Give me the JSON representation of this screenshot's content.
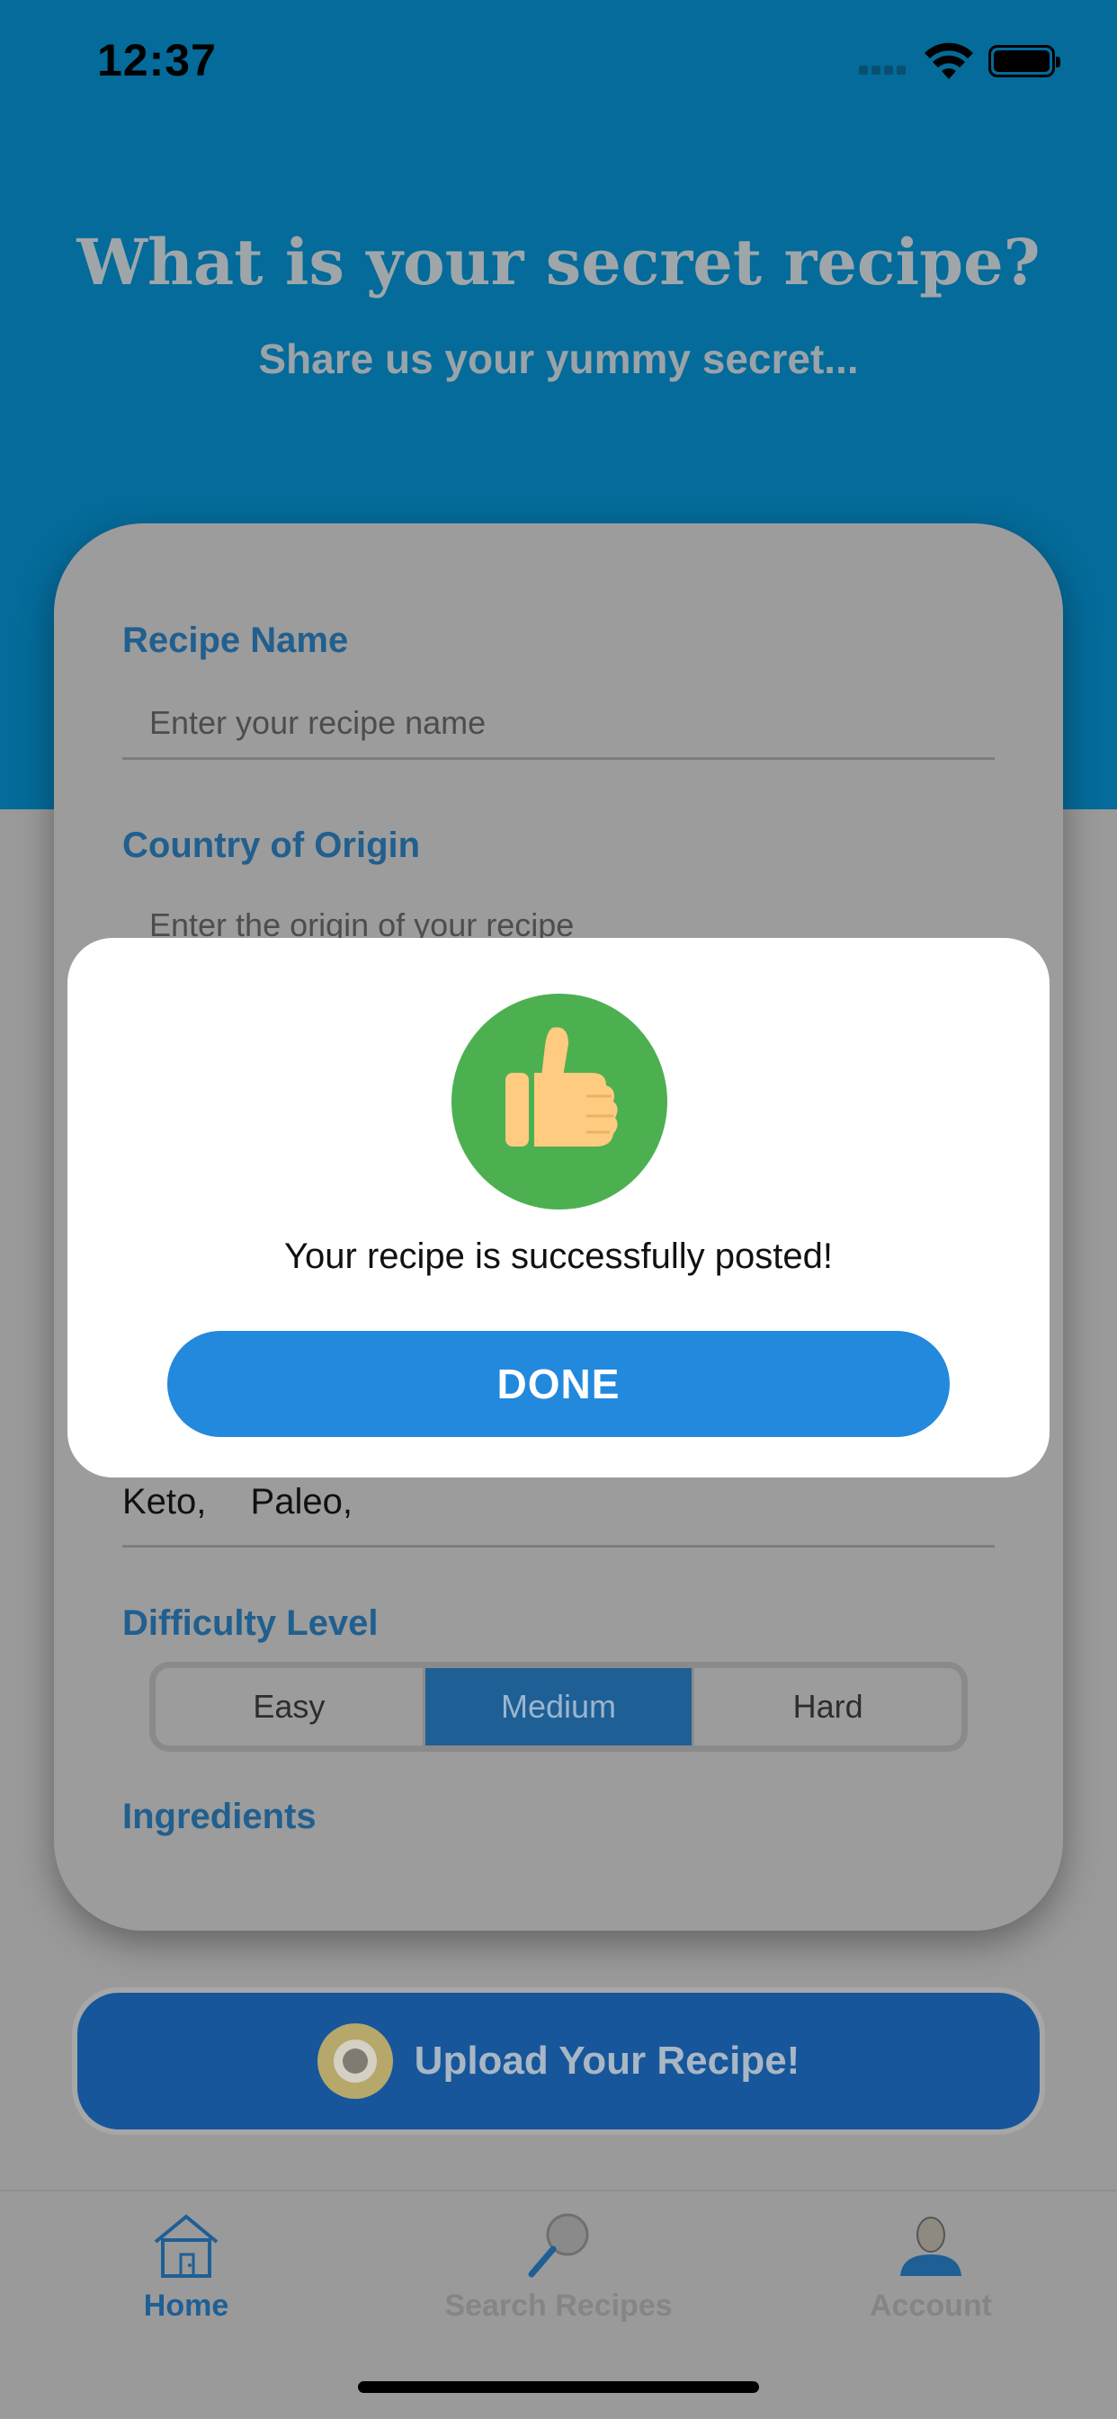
{
  "status_bar": {
    "time": "12:37"
  },
  "header": {
    "title": "What is your secret recipe?",
    "subtitle": "Share us your yummy secret..."
  },
  "form": {
    "recipe_name": {
      "label": "Recipe Name",
      "placeholder": "Enter your recipe name"
    },
    "country": {
      "label": "Country of Origin",
      "placeholder": "Enter the origin of your recipe"
    },
    "tags": [
      "Keto,",
      "Paleo,"
    ],
    "difficulty": {
      "label": "Difficulty Level",
      "options": [
        "Easy",
        "Medium",
        "Hard"
      ],
      "selected": "Medium"
    },
    "ingredients": {
      "label": "Ingredients"
    }
  },
  "upload_button": {
    "label": "Upload Your Recipe!"
  },
  "modal": {
    "message": "Your recipe is successfully posted!",
    "button": "DONE",
    "icon": "thumbs-up-icon"
  },
  "tabbar": {
    "items": [
      {
        "label": "Home",
        "icon": "home-icon",
        "active": true,
        "color": "#1e5f95"
      },
      {
        "label": "Search Recipes",
        "icon": "search-icon",
        "active": false,
        "color": "#858585"
      },
      {
        "label": "Account",
        "icon": "account-icon",
        "active": false,
        "color": "#858585"
      }
    ]
  },
  "colors": {
    "header_bg": "#046b9a",
    "overlay_bg": "#9a9a9a",
    "label_blue": "#215f8e",
    "done_button": "#2389dc",
    "success_green": "#4cb050"
  }
}
